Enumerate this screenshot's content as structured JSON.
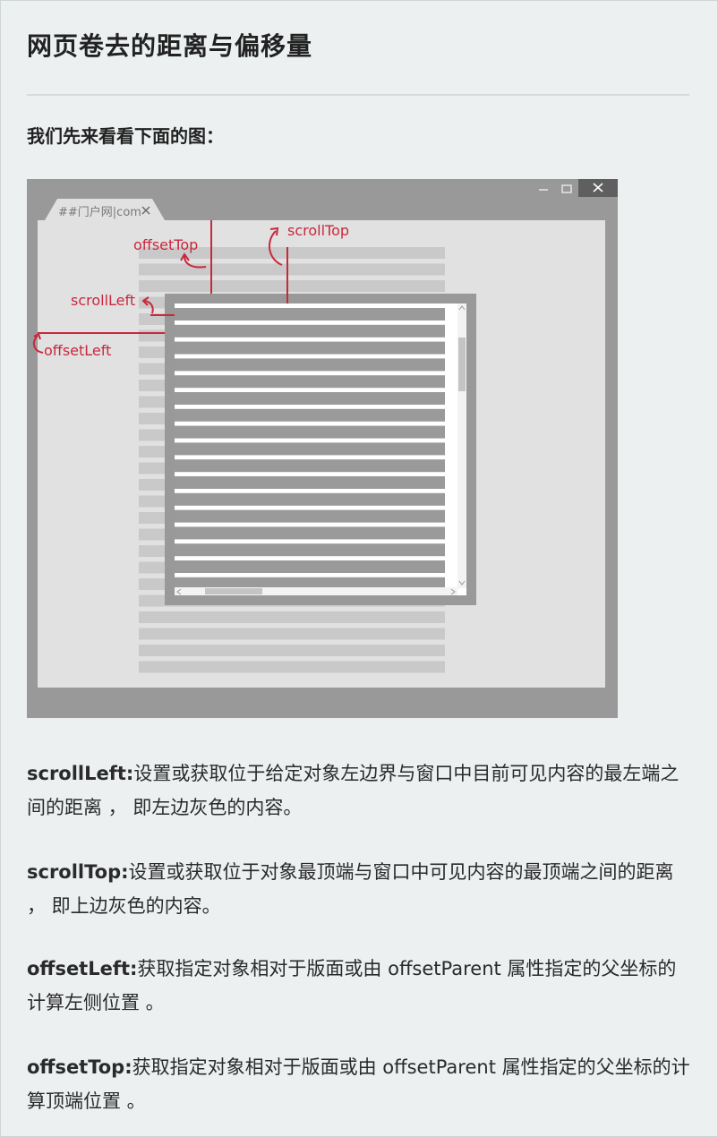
{
  "page": {
    "title": "网页卷去的距离与偏移量",
    "intro": "我们先来看看下面的图："
  },
  "figure": {
    "tab_label": "##门户网|com",
    "tab_close": "✕",
    "window_controls": {
      "minimize": "—",
      "maximize": "☐",
      "close": "✕"
    },
    "labels": {
      "offset_top": "offsetTop",
      "scroll_top": "scrollTop",
      "scroll_left": "scrollLeft",
      "offset_left": "offsetLeft"
    },
    "colors": {
      "annotation": "#c8283c",
      "window_frame": "#999999",
      "page_bg": "#e1e1e1",
      "content_line": "#c9c9c9",
      "inner_line": "#9a9a9a"
    }
  },
  "definitions": [
    {
      "term": "scrollLeft:",
      "text": "设置或获取位于给定对象左边界与窗口中目前可见内容的最左端之间的距离 ， 即左边灰色的内容。"
    },
    {
      "term": "scrollTop:",
      "text": "设置或获取位于对象最顶端与窗口中可见内容的最顶端之间的距离 ， 即上边灰色的内容。"
    },
    {
      "term": "offsetLeft:",
      "text": "获取指定对象相对于版面或由 offsetParent 属性指定的父坐标的计算左侧位置 。"
    },
    {
      "term": "offsetTop:",
      "text": "获取指定对象相对于版面或由 offsetParent 属性指定的父坐标的计算顶端位置 。"
    }
  ]
}
